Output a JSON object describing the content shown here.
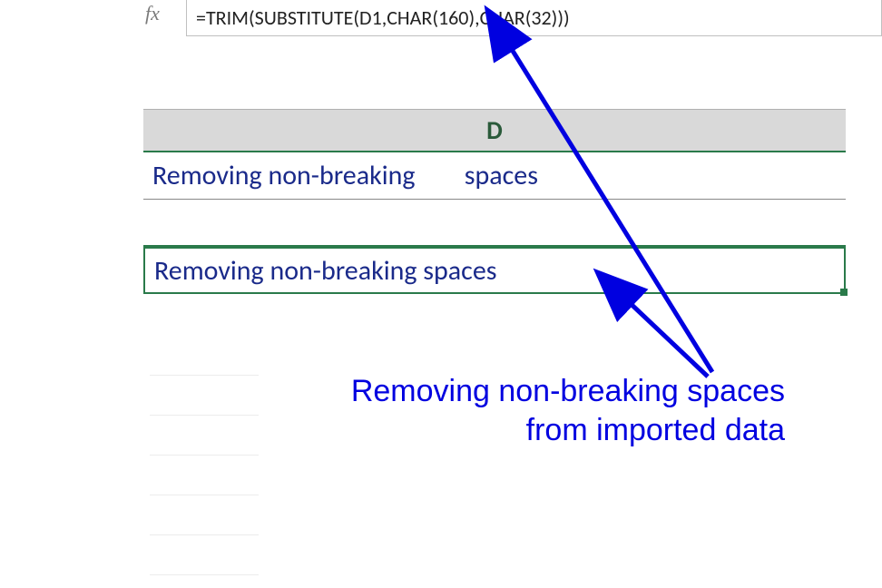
{
  "formula_bar": {
    "fx_label": "fx",
    "formula": "=TRIM(SUBSTITUTE(D1,CHAR(160),CHAR(32)))"
  },
  "column": {
    "header": "D"
  },
  "cells": {
    "d1": "Removing non-breaking        spaces",
    "d3": "Removing non-breaking spaces"
  },
  "annotation": "Removing non-breaking spaces from imported data"
}
